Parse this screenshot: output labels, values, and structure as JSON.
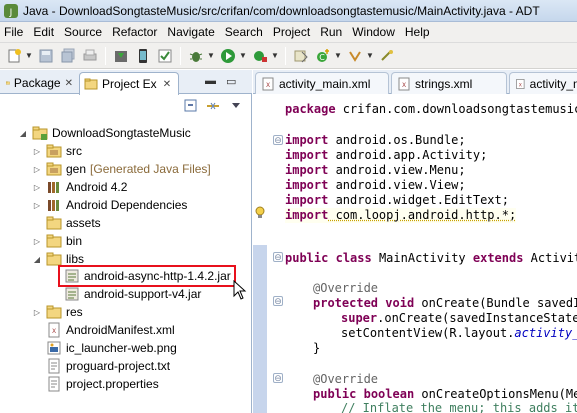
{
  "window": {
    "title": "Java - DownloadSongtasteMusic/src/crifan/com/downloadsongtastemusic/MainActivity.java - ADT"
  },
  "menu": [
    "File",
    "Edit",
    "Source",
    "Refactor",
    "Navigate",
    "Search",
    "Project",
    "Run",
    "Window",
    "Help"
  ],
  "left_panel": {
    "tabs": [
      "Package",
      "Project Ex"
    ],
    "tree": [
      {
        "label": "DownloadSongtasteMusic",
        "icon": "project-icon",
        "expanded": true
      },
      {
        "label": "src",
        "icon": "source-folder-icon"
      },
      {
        "label": "gen",
        "suffix": "[Generated Java Files]",
        "icon": "source-folder-icon"
      },
      {
        "label": "Android 4.2",
        "icon": "library-icon"
      },
      {
        "label": "Android Dependencies",
        "icon": "library-icon"
      },
      {
        "label": "assets",
        "icon": "folder-icon"
      },
      {
        "label": "bin",
        "icon": "folder-icon"
      },
      {
        "label": "libs",
        "icon": "folder-icon",
        "expanded": true
      },
      {
        "label": "android-async-http-1.4.2.jar",
        "icon": "jar-icon",
        "selected": true
      },
      {
        "label": "android-support-v4.jar",
        "icon": "jar-icon"
      },
      {
        "label": "res",
        "icon": "folder-icon"
      },
      {
        "label": "AndroidManifest.xml",
        "icon": "xml-file-icon"
      },
      {
        "label": "ic_launcher-web.png",
        "icon": "image-file-icon"
      },
      {
        "label": "proguard-project.txt",
        "icon": "text-file-icon"
      },
      {
        "label": "project.properties",
        "icon": "properties-file-icon"
      }
    ]
  },
  "editor": {
    "tabs": [
      "activity_main.xml",
      "strings.xml",
      "activity_m"
    ],
    "code": {
      "package_kw": "package",
      "package_rest": " crifan.com.downloadsongtastemusic",
      "import_kw": "import",
      "imports": [
        " android.os.Bundle;",
        " android.app.Activity;",
        " android.view.Menu;",
        " android.view.View;",
        " android.widget.EditText;",
        " com.loopj.android.http.*;"
      ],
      "class_kw1": "public",
      "class_kw2": "class",
      "class_name": " MainActivity ",
      "class_kw3": "extends",
      "class_rest": " Activit",
      "override1": "@Override",
      "oncreate_kw1": "protected",
      "oncreate_kw2": "void",
      "oncreate_rest": " onCreate(Bundle savedI",
      "super_kw": "super",
      "super_rest": ".onCreate(savedInstanceState",
      "setcontent_pre": "setContentView(R.layout.",
      "setcontent_field": "activity_",
      "close_brace": "}",
      "override2": "@Override",
      "menu_kw1": "public",
      "menu_kw2": "boolean",
      "menu_rest": " onCreateOptionsMenu(Me",
      "comment": "// Inflate the menu; this adds it"
    }
  }
}
